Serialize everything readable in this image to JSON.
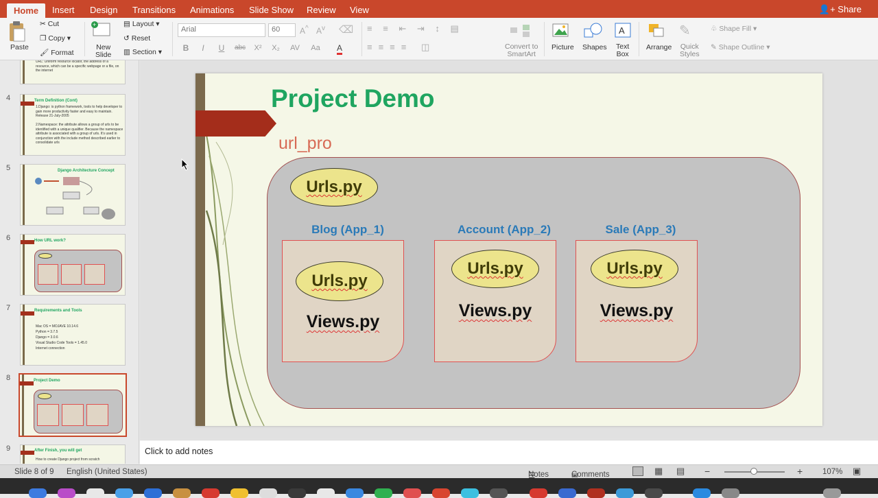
{
  "ribbon": {
    "tabs": [
      "Home",
      "Insert",
      "Design",
      "Transitions",
      "Animations",
      "Slide Show",
      "Review",
      "View"
    ],
    "share": "Share"
  },
  "toolbar": {
    "paste": "Paste",
    "cut": "Cut",
    "copy": "Copy",
    "format": "Format",
    "new_slide_1": "New",
    "new_slide_2": "Slide",
    "layout": "Layout",
    "reset": "Reset",
    "section": "Section",
    "font_name": "Arial",
    "font_size": "60",
    "convert_1": "Convert to",
    "convert_2": "SmartArt",
    "picture": "Picture",
    "shapes": "Shapes",
    "textbox_1": "Text",
    "textbox_2": "Box",
    "arrange": "Arrange",
    "quick_1": "Quick",
    "quick_2": "Styles",
    "shape_fill": "Shape Fill",
    "shape_outline": "Shape Outline"
  },
  "thumbnails": [
    {
      "num": "4",
      "title": "Term Definition (Cont)",
      "body": "1.Django: is python framework, tools to help developer to gain more productivity faster and easy to maintain. Release 21-July-2005\n\n2.Namespace: the attribute allows a group of urls to be identified with a unique qualifier. Because the namespace attribute is associated with a group of urls. It's used in conjunction with the include method described earlier to consolidate urls"
    },
    {
      "num": "5",
      "title": "Django Architecture Concept",
      "body": ""
    },
    {
      "num": "6",
      "title": "How URL work?",
      "body": ""
    },
    {
      "num": "7",
      "title": "Requirements and Tools",
      "body": "Mac OS = MOJAVE 10.14.6\nPython = 3.7.5\nDjango = 3.0.6\nVisual Studio Code Tools = 1.45.0\nInternet connection"
    },
    {
      "num": "8",
      "title": "Project Demo",
      "body": ""
    },
    {
      "num": "9",
      "title": "After Finish, you will get",
      "body": "How to create Django project from scratch"
    }
  ],
  "thumb_top_text": "URL: Uniform resource locator, the address of a resource, which can be a specific webpage or a file, on the internet",
  "slide": {
    "title": "Project Demo",
    "subtitle": "url_pro",
    "root_urls": "Urls.py",
    "apps": [
      {
        "label": "Blog (App_1)",
        "urls": "Urls.py",
        "views": "Views.py"
      },
      {
        "label": "Account (App_2)",
        "urls": "Urls.py",
        "views": "Views.py"
      },
      {
        "label": "Sale (App_3)",
        "urls": "Urls.py",
        "views": "Views.py"
      }
    ]
  },
  "notes_placeholder": "Click to add notes",
  "status": {
    "slide": "Slide 8 of 9",
    "language": "English (United States)",
    "notes": "Notes",
    "comments": "Comments",
    "zoom": "107%"
  },
  "colors": {
    "ribbon": "#c9472b",
    "title_green": "#1fa560",
    "app_label_blue": "#2a7ab8"
  }
}
